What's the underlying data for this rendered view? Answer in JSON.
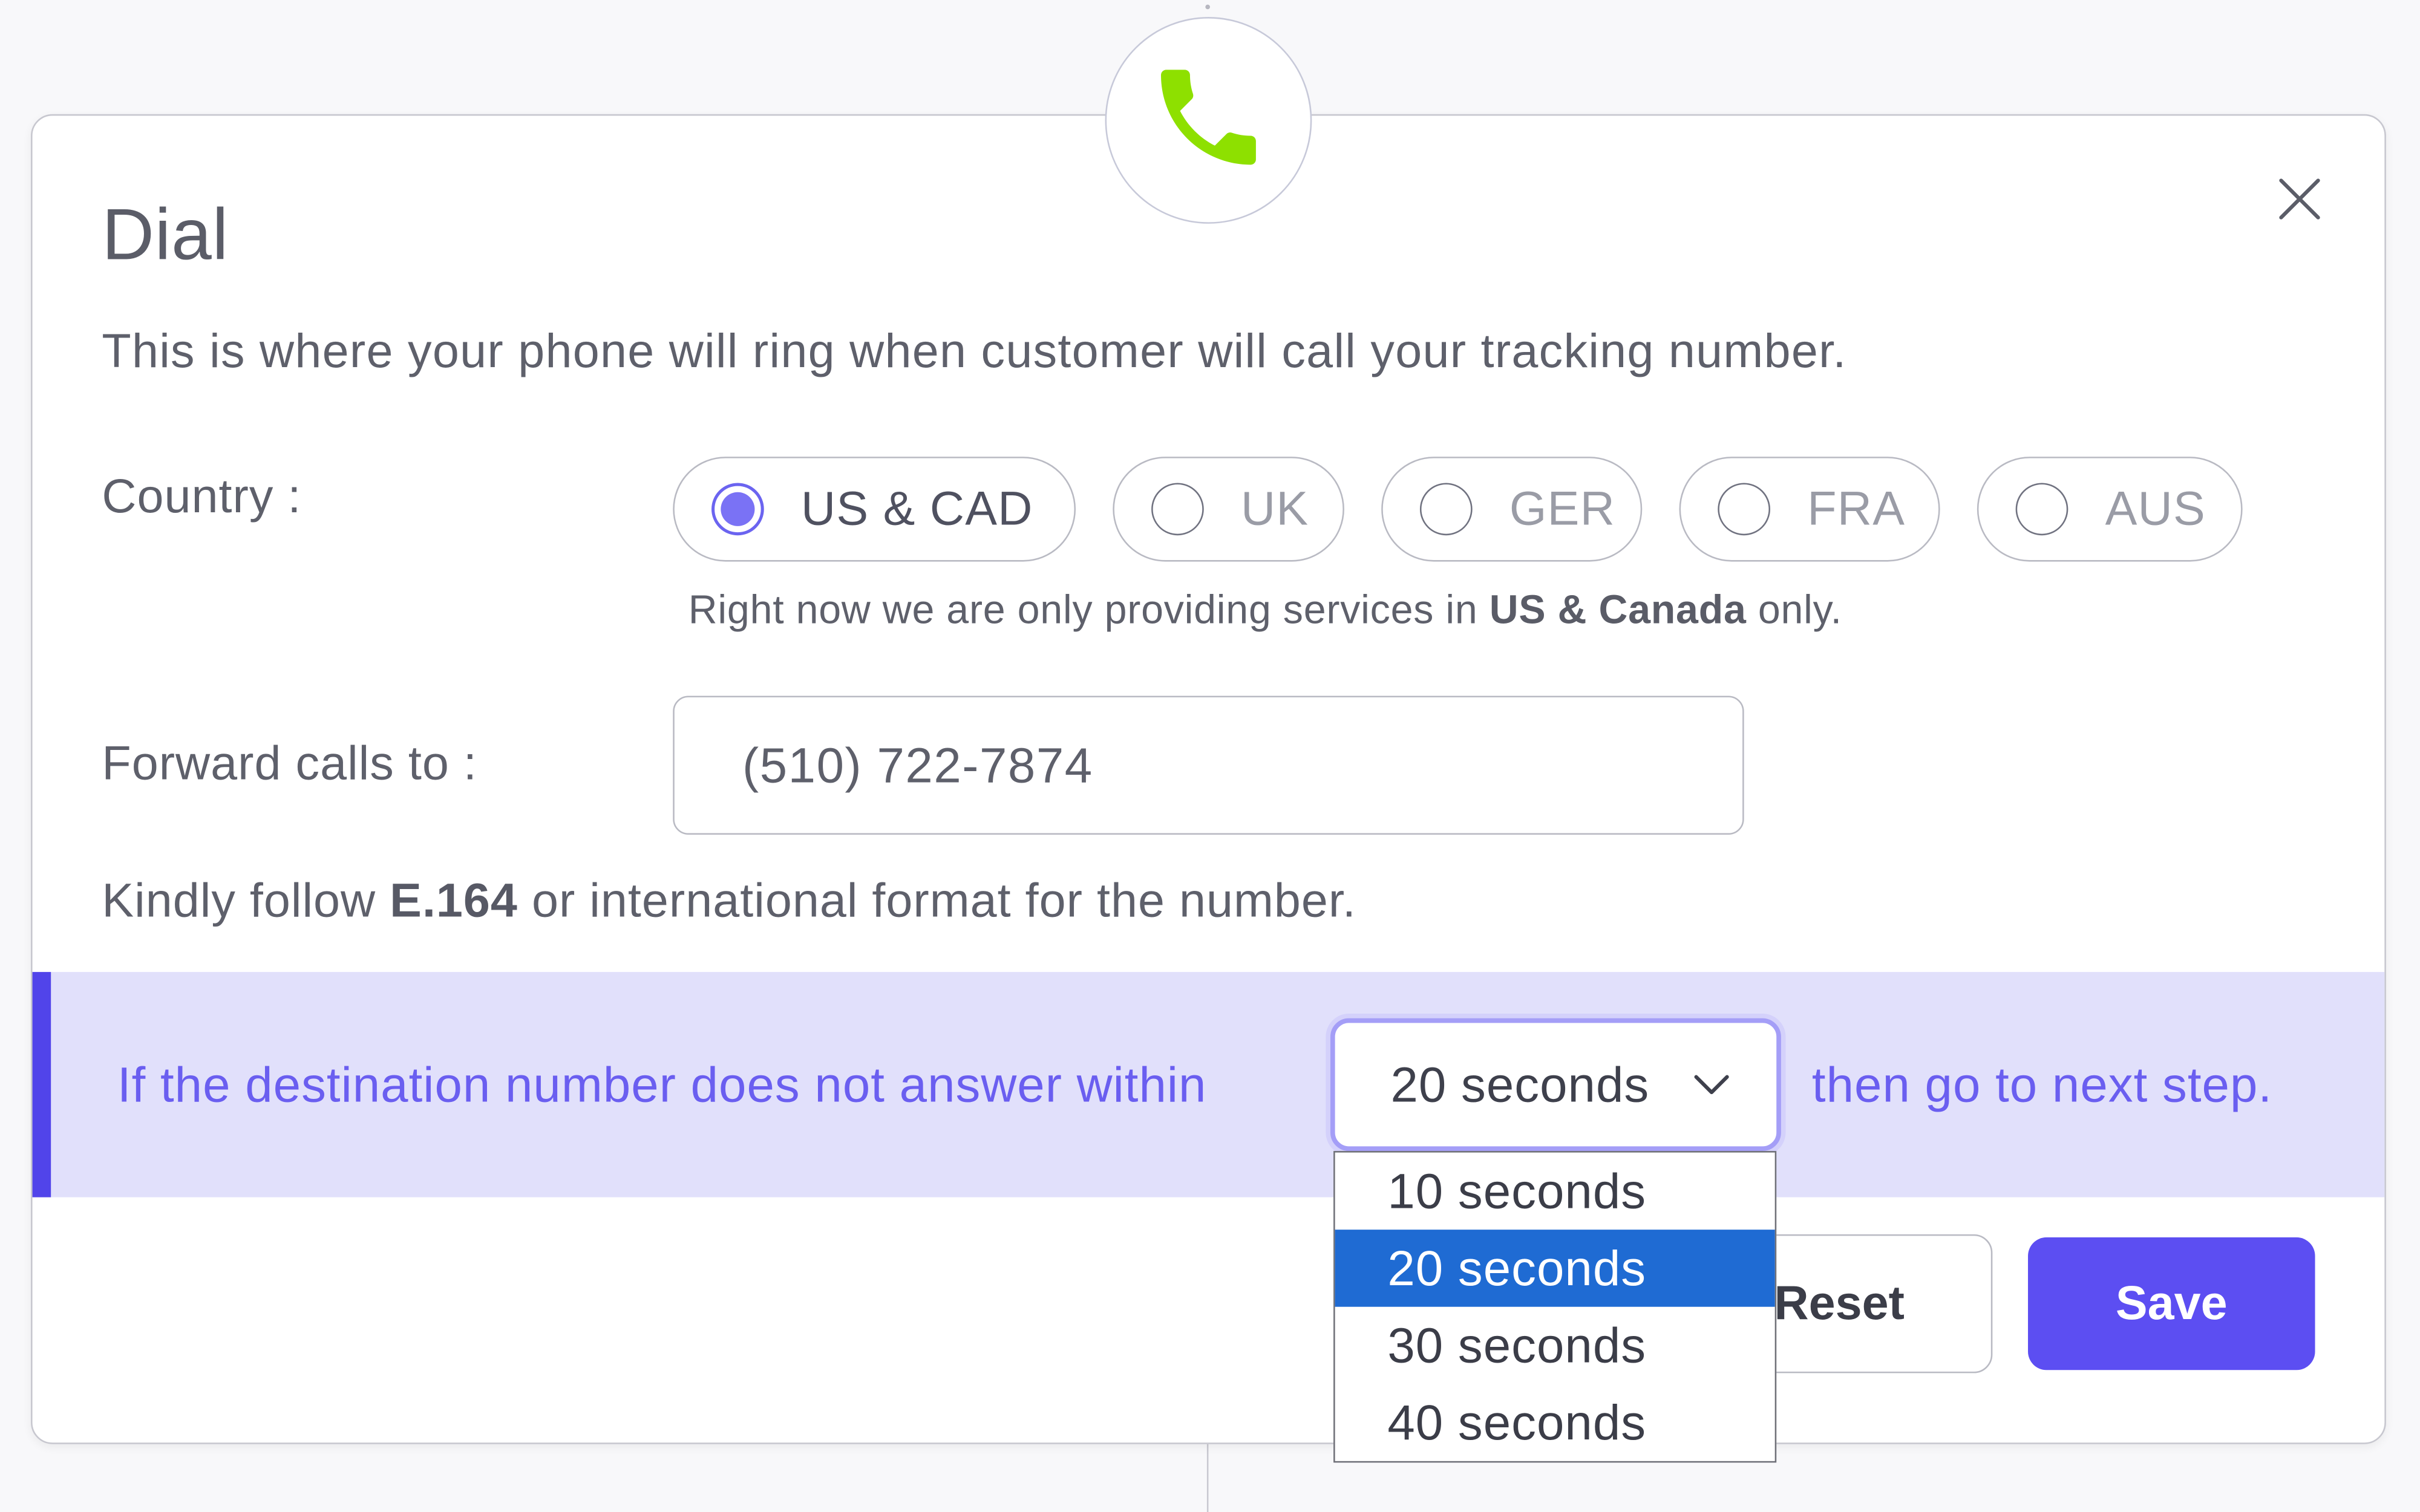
{
  "dialog": {
    "title": "Dial",
    "description": "This is where your phone will ring when customer will call your tracking number.",
    "icons": {
      "badge": "phone-icon",
      "close": "close-icon",
      "dropdown": "chevron-down-icon"
    }
  },
  "country": {
    "label": "Country :",
    "options": [
      {
        "label": "US & CAD",
        "selected": true
      },
      {
        "label": "UK",
        "selected": false
      },
      {
        "label": "GER",
        "selected": false
      },
      {
        "label": "FRA",
        "selected": false
      },
      {
        "label": "AUS",
        "selected": false
      }
    ],
    "note_prefix": "Right now we are only providing services in ",
    "note_bold": "US & Canada",
    "note_suffix": " only."
  },
  "forward": {
    "label": "Forward calls to :",
    "value": "(510) 722-7874",
    "hint_prefix": "Kindly follow ",
    "hint_bold": "E.164",
    "hint_suffix": " or international format for the number."
  },
  "timeout": {
    "prefix": "If the destination number does not answer within",
    "selected": "20 seconds",
    "suffix": "then go to next step.",
    "options": [
      "10 seconds",
      "20 seconds",
      "30 seconds",
      "40 seconds"
    ],
    "selected_index": 1
  },
  "actions": {
    "reset_label": "Reset",
    "save_label": "Save"
  },
  "colors": {
    "accent": "#5c4ef2",
    "phone_green": "#8ee000",
    "band_background": "#e1e0fb",
    "band_text": "#6a5ef0",
    "dropdown_highlight": "#1f6bd3"
  }
}
